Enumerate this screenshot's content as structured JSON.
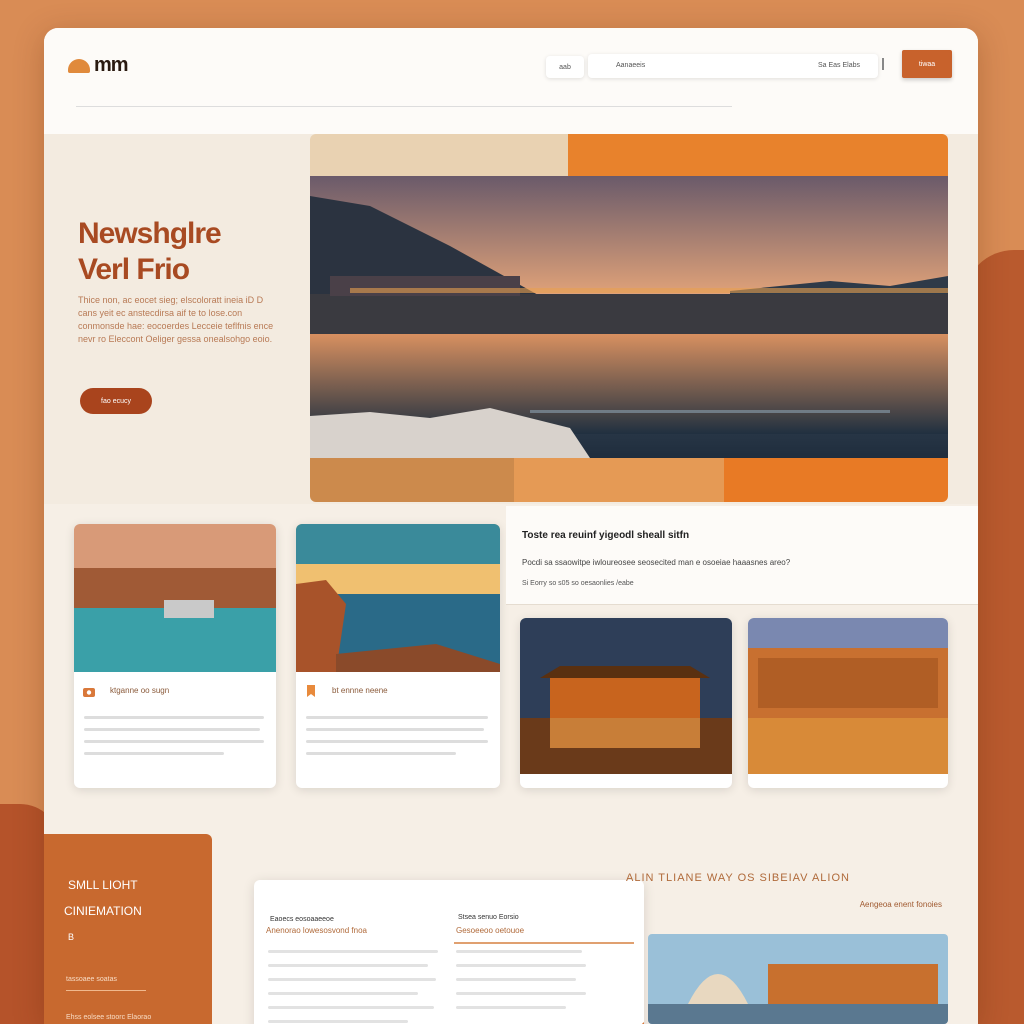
{
  "header": {
    "logo_text": "mm",
    "nav_item": "aab",
    "search_label": "Aanaeeis",
    "search_hint": "Sa Eas Elabs",
    "cta_label": "tiwaa"
  },
  "hero": {
    "title_line1": "Newshglre",
    "title_line2": "Verl Frio",
    "description": "Thice non, ac eocet sieg; elscoloratt ineia iD D cans yeit ec anstecdirsa aif te to lose.con conmonsde hae: eocoerdes Lecceie teflfnis ence nevr ro Eleccont Oeliger gessa onealsohgo eoio.",
    "button_label": "fao ecucy"
  },
  "cards": [
    {
      "title": "ktganne oo sugn",
      "icon": "camera-icon"
    },
    {
      "title": "bt ennne neene",
      "icon": "bookmark-icon"
    }
  ],
  "feature": {
    "title": "Toste rea reuinf yigeodl sheall sitfn",
    "subtitle": "Pocdi sa ssaowitpe iwloureosee seosecited man e osoeiae haaasnes areo?",
    "meta": "Si Eorry so s05 so oesaonlies /eabe"
  },
  "side_panel": {
    "line1": "SMLL LIOHT",
    "line2": "CINIEMATION",
    "line3": "B",
    "line4": "tassoaee soatas",
    "line5": "Ehss eolsee stoorc Elaorao"
  },
  "article": {
    "col1_head": "Eaoecs eosoaaeeoe",
    "col1_title": "Anenorao lowesosvond fnoa",
    "col2_head": "Stsea senuo Eorsio",
    "col2_title": "Gesoeeoo oetouoe"
  },
  "promo": {
    "heading": "ALIN TLIANE WAY OS SIBEIAV ALION",
    "link": "Aengeoa enent fonoies"
  }
}
